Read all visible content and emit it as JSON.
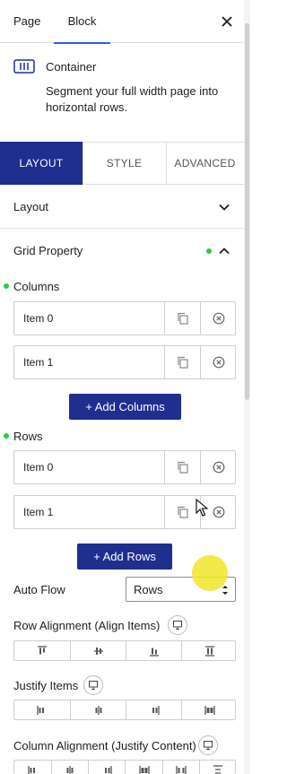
{
  "header": {
    "tabs": [
      {
        "label": "Page"
      },
      {
        "label": "Block"
      }
    ]
  },
  "block": {
    "name": "Container",
    "description": "Segment your full width page into horizontal rows."
  },
  "sub_tabs": [
    {
      "label": "LAYOUT"
    },
    {
      "label": "STYLE"
    },
    {
      "label": "ADVANCED"
    }
  ],
  "panels": {
    "layout": "Layout",
    "grid_property": "Grid Property"
  },
  "columns": {
    "label": "Columns",
    "items": [
      {
        "label": "Item 0"
      },
      {
        "label": "Item 1"
      }
    ],
    "add_label": "+ Add Columns"
  },
  "rows": {
    "label": "Rows",
    "items": [
      {
        "label": "Item 0"
      },
      {
        "label": "Item 1"
      }
    ],
    "add_label": "+ Add Rows"
  },
  "auto_flow": {
    "label": "Auto Flow",
    "value": "Rows"
  },
  "row_alignment": {
    "label": "Row Alignment (Align Items)"
  },
  "justify_items": {
    "label": "Justify Items"
  },
  "column_alignment": {
    "label": "Column Alignment (Justify Content)"
  },
  "colors": {
    "accent": "#1f2e8f",
    "active_underline": "#3858e9",
    "indicator": "#2ecc40"
  }
}
